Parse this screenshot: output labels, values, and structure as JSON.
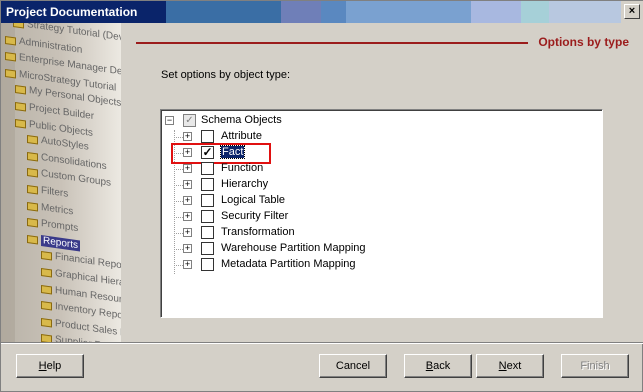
{
  "window": {
    "title": "Project Documentation",
    "close_glyph": "×"
  },
  "sidebar_tree": [
    {
      "label": "Strategy Tutorial (Dev",
      "highlight": false
    },
    {
      "label": "Administration",
      "highlight": false
    },
    {
      "label": "Enterprise Manager Demo",
      "highlight": false
    },
    {
      "label": "MicroStrategy Tutorial",
      "highlight": false
    },
    {
      "label": "My Personal Objects",
      "highlight": false
    },
    {
      "label": "Project Builder",
      "highlight": false
    },
    {
      "label": "Public Objects",
      "highlight": false
    },
    {
      "label": "AutoStyles",
      "highlight": false
    },
    {
      "label": "Consolidations",
      "highlight": false
    },
    {
      "label": "Custom Groups",
      "highlight": false
    },
    {
      "label": "Filters",
      "highlight": false
    },
    {
      "label": "Metrics",
      "highlight": false
    },
    {
      "label": "Prompts",
      "highlight": false
    },
    {
      "label": "Reports",
      "highlight": true
    },
    {
      "label": "Financial Repo",
      "highlight": false
    },
    {
      "label": "Graphical Hiera",
      "highlight": false
    },
    {
      "label": "Human Resour",
      "highlight": false
    },
    {
      "label": "Inventory Repo",
      "highlight": false
    },
    {
      "label": "Product Sales F",
      "highlight": false
    },
    {
      "label": "Supplier Repo",
      "highlight": false
    }
  ],
  "header": {
    "title": "Options by type",
    "accent_color": "#9b1c1c"
  },
  "instruction": "Set options by object type:",
  "tree": {
    "root": {
      "label": "Schema Objects",
      "expander": "−"
    },
    "children": [
      {
        "label": "Attribute",
        "checked": false,
        "expander": "+"
      },
      {
        "label": "Fact",
        "checked": true,
        "expander": "+",
        "focused": true
      },
      {
        "label": "Function",
        "checked": false,
        "expander": "+"
      },
      {
        "label": "Hierarchy",
        "checked": false,
        "expander": "+"
      },
      {
        "label": "Logical Table",
        "checked": false,
        "expander": "+"
      },
      {
        "label": "Security Filter",
        "checked": false,
        "expander": "+"
      },
      {
        "label": "Transformation",
        "checked": false,
        "expander": "+"
      },
      {
        "label": "Warehouse Partition Mapping",
        "checked": false,
        "expander": "+"
      },
      {
        "label": "Metadata Partition Mapping",
        "checked": false,
        "expander": "+"
      }
    ]
  },
  "buttons": {
    "help": {
      "mnemonic": "H",
      "rest": "elp"
    },
    "cancel": {
      "label": "Cancel"
    },
    "back": {
      "mnemonic": "B",
      "rest": "ack"
    },
    "next": {
      "mnemonic": "N",
      "rest": "ext"
    },
    "finish": {
      "label": "Finish",
      "enabled": false
    }
  }
}
